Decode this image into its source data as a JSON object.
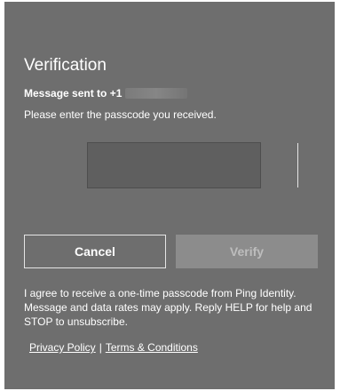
{
  "dialog": {
    "title": "Verification",
    "sent_prefix": "Message sent to +1",
    "prompt": "Please enter the passcode you received.",
    "code_input": {
      "value": "",
      "placeholder": ""
    },
    "buttons": {
      "cancel_label": "Cancel",
      "verify_label": "Verify"
    },
    "consent_text": "I agree to receive a one-time passcode from Ping Identity. Message and data rates may apply. Reply HELP for help and STOP to unsubscribe.",
    "links": {
      "privacy": "Privacy Policy",
      "separator": "|",
      "terms": "Terms & Conditions"
    }
  },
  "colors": {
    "panel": "#6e6e6e",
    "input_bg": "#5f5f5f",
    "verify_disabled_bg": "#8c8c8c",
    "text": "#ffffff"
  }
}
